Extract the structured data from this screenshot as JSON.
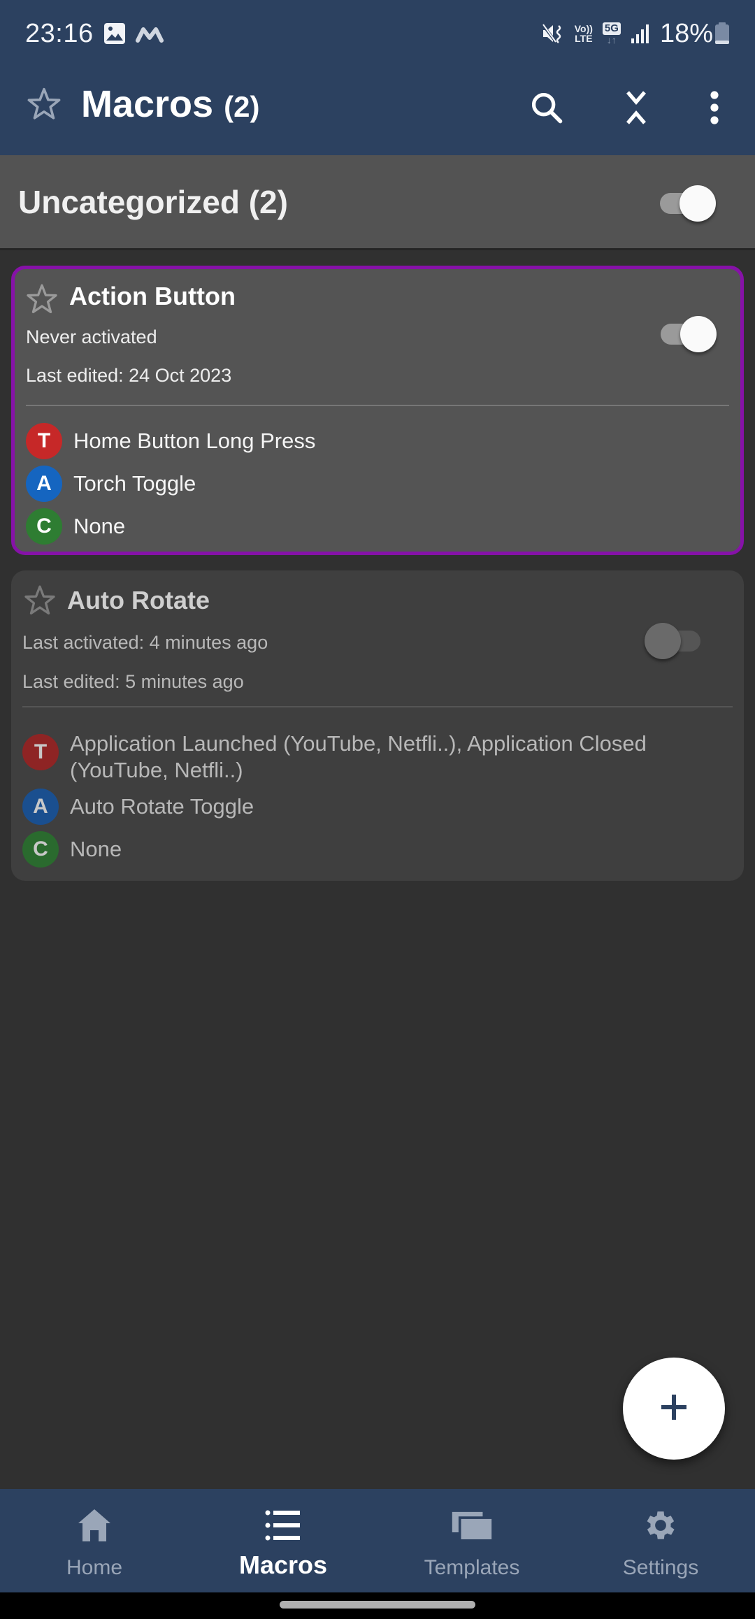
{
  "status_bar": {
    "time": "23:16",
    "left_icons": [
      "gallery-icon",
      "macrodroid-icon"
    ],
    "right_icons": [
      "mute-vibrate-icon",
      "volte-icon",
      "5g-data-icon",
      "signal-icon"
    ],
    "volte_line1": "Vo))",
    "volte_line2": "LTE",
    "network": "5G",
    "network_arrows": "↓↑",
    "battery": "18%"
  },
  "app_bar": {
    "title": "Macros",
    "count": "(2)",
    "actions": [
      "search-icon",
      "collapse-all-icon",
      "more-options-icon"
    ]
  },
  "category": {
    "title": "Uncategorized (2)",
    "enabled": true
  },
  "macros": [
    {
      "name": "Action Button",
      "favorite": false,
      "enabled": true,
      "selected": true,
      "activation": "Never activated",
      "edited": "Last edited: 24 Oct 2023",
      "rows": [
        {
          "badge": "T",
          "kind": "trigger",
          "color": "#c62828",
          "text": "Home Button Long Press"
        },
        {
          "badge": "A",
          "kind": "action",
          "color": "#1565c0",
          "text": "Torch Toggle"
        },
        {
          "badge": "C",
          "kind": "constraint",
          "color": "#2e7d32",
          "text": "None"
        }
      ]
    },
    {
      "name": "Auto Rotate",
      "favorite": false,
      "enabled": false,
      "selected": false,
      "activation": "Last activated: 4 minutes ago",
      "edited": "Last edited: 5 minutes ago",
      "rows": [
        {
          "badge": "T",
          "kind": "trigger",
          "color": "#8e2424",
          "text": "Application Launched (YouTube, Netfli..), Application Closed (YouTube, Netfli..)"
        },
        {
          "badge": "A",
          "kind": "action",
          "color": "#1a4f8f",
          "text": "Auto Rotate Toggle"
        },
        {
          "badge": "C",
          "kind": "constraint",
          "color": "#2a6a2e",
          "text": "None"
        }
      ]
    }
  ],
  "fab": {
    "icon": "plus-icon",
    "label": "Add macro"
  },
  "bottom_nav": {
    "items": [
      {
        "label": "Home",
        "icon": "home-icon",
        "active": false
      },
      {
        "label": "Macros",
        "icon": "list-icon",
        "active": true
      },
      {
        "label": "Templates",
        "icon": "templates-icon",
        "active": false
      },
      {
        "label": "Settings",
        "icon": "gear-icon",
        "active": false
      }
    ]
  },
  "colors": {
    "primary": "#2c4160",
    "selected_outline": "#8612a8",
    "background": "#303030",
    "trigger": "#c62828",
    "action": "#1565c0",
    "constraint": "#2e7d32"
  }
}
